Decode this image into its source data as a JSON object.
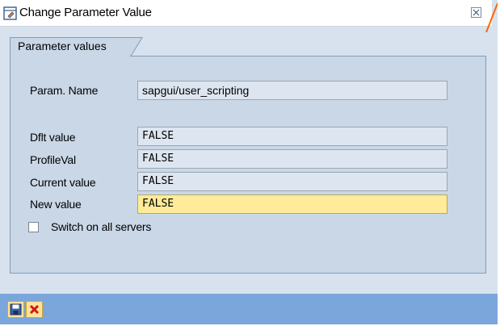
{
  "window": {
    "title": "Change Parameter Value"
  },
  "group": {
    "tab_label": "Parameter values"
  },
  "param": {
    "name_label": "Param. Name",
    "name_value": "sapgui/user_scripting"
  },
  "values": {
    "default_label": "Dflt value",
    "default_value": "FALSE",
    "profile_label": "ProfileVal",
    "profile_value": "FALSE",
    "current_label": "Current value",
    "current_value": "FALSE",
    "new_label": "New value",
    "new_value": "FALSE"
  },
  "options": {
    "switch_all_label": "Switch on all servers",
    "switch_all_checked": false
  },
  "toolbar": {
    "save_icon": "floppy-disk-icon",
    "cancel_icon": "red-x-icon"
  },
  "colors": {
    "dialog_bg": "#d8e2ee",
    "toolbar_bg": "#7ba6dc",
    "new_value_bg": "#ffeb99",
    "accent_orange": "#ff6600"
  }
}
